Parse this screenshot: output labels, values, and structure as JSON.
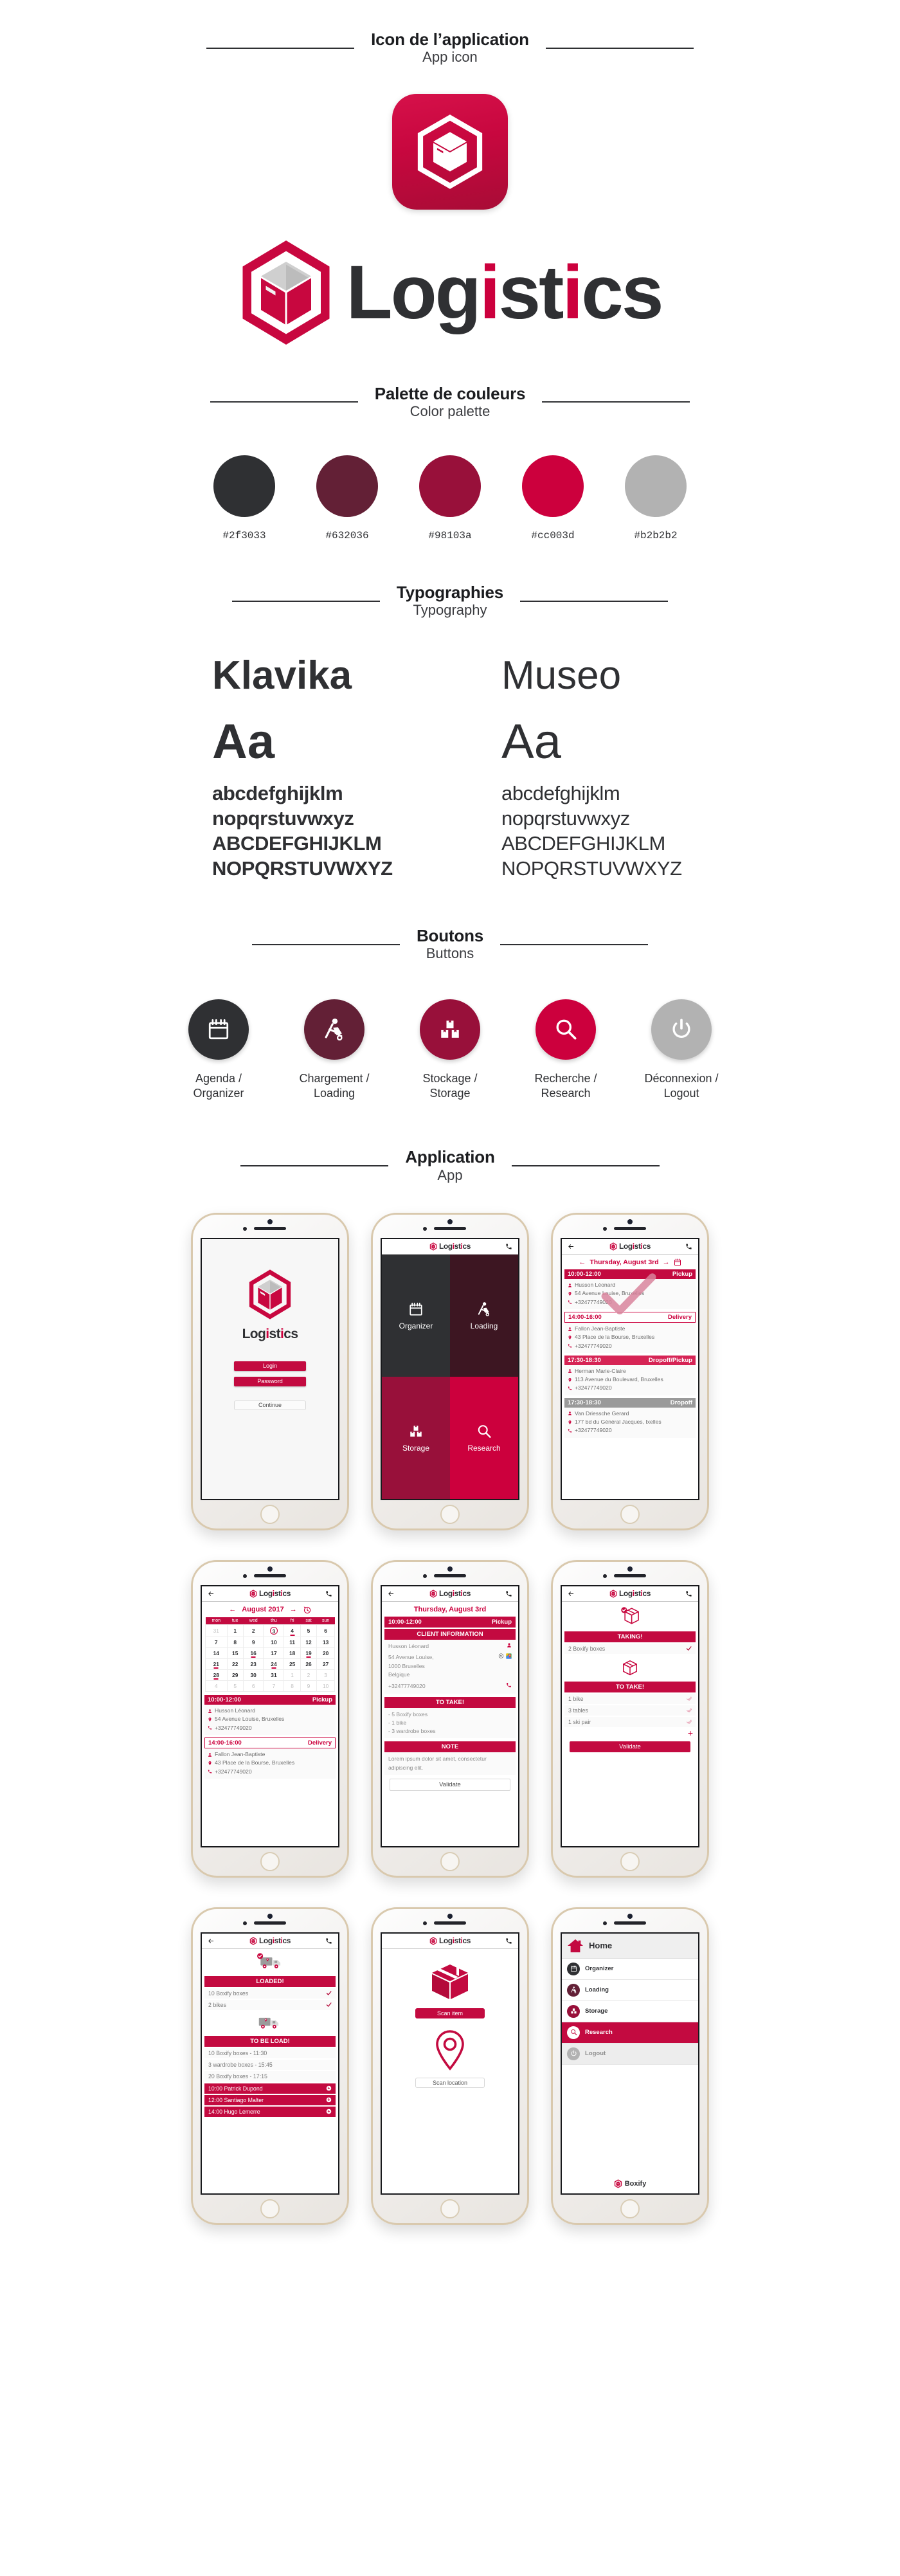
{
  "brand": {
    "name": "Logistics",
    "name_prefix": "Log",
    "name_dot": "i",
    "name_mid": "st",
    "name_dot2": "i",
    "name_suffix": "cs"
  },
  "sections": {
    "app_icon": {
      "fr": "Icon de l’application",
      "en": "App icon"
    },
    "palette": {
      "fr": "Palette de couleurs",
      "en": "Color palette"
    },
    "typography": {
      "fr": "Typographies",
      "en": "Typography"
    },
    "buttons": {
      "fr": "Boutons",
      "en": "Buttons"
    },
    "application": {
      "fr": "Application",
      "en": "App"
    }
  },
  "palette": [
    {
      "hex": "#2f3033",
      "label": "#2f3033"
    },
    {
      "hex": "#632036",
      "label": "#632036"
    },
    {
      "hex": "#98103a",
      "label": "#98103a"
    },
    {
      "hex": "#cc003d",
      "label": "#cc003d"
    },
    {
      "hex": "#b2b2b2",
      "label": "#b2b2b2"
    }
  ],
  "typography": [
    {
      "name": "Klavika",
      "aa": "Aa",
      "lines": [
        "abcdefghijklm",
        "nopqrstuvwxyz",
        "ABCDEFGHIJKLM",
        "NOPQRSTUVWXYZ"
      ]
    },
    {
      "name": "Museo",
      "aa": "Aa",
      "lines": [
        "abcdefghijklm",
        "nopqrstuvwxyz",
        "ABCDEFGHIJKLM",
        "NOPQRSTUVWXYZ"
      ]
    }
  ],
  "buttons": [
    {
      "icon": "calendar-icon",
      "color": "#2f3033",
      "line1": "Agenda /",
      "line2": "Organizer"
    },
    {
      "icon": "handtruck-icon",
      "color": "#632036",
      "line1": "Chargement /",
      "line2": "Loading"
    },
    {
      "icon": "boxes-icon",
      "color": "#98103a",
      "line1": "Stockage /",
      "line2": "Storage"
    },
    {
      "icon": "search-icon",
      "color": "#cc003d",
      "line1": "Recherche /",
      "line2": "Research"
    },
    {
      "icon": "power-icon",
      "color": "#b2b2b2",
      "line1": "Déconnexion /",
      "line2": "Logout"
    }
  ],
  "screens": {
    "login": {
      "title": "Logistics",
      "login_label": "Login",
      "password_label": "Password",
      "continue_label": "Continue"
    },
    "tiles": [
      {
        "label": "Organizer",
        "color": "#2f3033",
        "icon": "calendar-icon"
      },
      {
        "label": "Loading",
        "color": "#3d1622",
        "icon": "handtruck-icon"
      },
      {
        "label": "Storage",
        "color": "#98103a",
        "icon": "boxes-icon"
      },
      {
        "label": "Research",
        "color": "#cc003d",
        "icon": "search-icon"
      }
    ],
    "schedule": {
      "day_label": "Thursday, August 3rd",
      "prev_arrow": "←",
      "next_arrow": "→",
      "appointments": [
        {
          "time": "10:00-12:00",
          "type": "Pickup",
          "style": "solid-dark",
          "name": "Husson Léonard",
          "address": "54 Avenue Louise, Bruxelles",
          "phone": "+32477749020"
        },
        {
          "time": "14:00-16:00",
          "type": "Delivery",
          "style": "outline",
          "name": "Fallon Jean-Baptiste",
          "address": "43 Place de la Bourse, Bruxelles",
          "phone": "+32477749020"
        },
        {
          "time": "17:30-18:30",
          "type": "Dropoff/Pickup",
          "style": "pink",
          "name": "Herman Marie-Claire",
          "address": "113 Avenue du Boulevard, Bruxelles",
          "phone": "+32477749020"
        },
        {
          "time": "17:30-18:30",
          "type": "Dropoff",
          "style": "gray",
          "name": "Van Driessche Gerard",
          "address": "177 bd du Général Jacques, Ixelles",
          "phone": "+32477749020"
        }
      ]
    },
    "calendar": {
      "month": "August 2017",
      "prev_arrow": "←",
      "next_arrow": "→",
      "weekdays": [
        "mon",
        "tue",
        "wed",
        "thu",
        "fri",
        "sat",
        "sun"
      ],
      "weeks": [
        [
          {
            "d": "31",
            "mute": true
          },
          {
            "d": "1"
          },
          {
            "d": "2"
          },
          {
            "d": "3",
            "sel": true
          },
          {
            "d": "4",
            "dots": true
          },
          {
            "d": "5"
          },
          {
            "d": "6"
          }
        ],
        [
          {
            "d": "7"
          },
          {
            "d": "8"
          },
          {
            "d": "9"
          },
          {
            "d": "10"
          },
          {
            "d": "11"
          },
          {
            "d": "12"
          },
          {
            "d": "13"
          }
        ],
        [
          {
            "d": "14"
          },
          {
            "d": "15"
          },
          {
            "d": "16",
            "dots": true
          },
          {
            "d": "17"
          },
          {
            "d": "18"
          },
          {
            "d": "19",
            "dots": true
          },
          {
            "d": "20"
          }
        ],
        [
          {
            "d": "21",
            "dots": true
          },
          {
            "d": "22"
          },
          {
            "d": "23"
          },
          {
            "d": "24",
            "dots": true
          },
          {
            "d": "25"
          },
          {
            "d": "26"
          },
          {
            "d": "27"
          }
        ],
        [
          {
            "d": "28",
            "dots": true
          },
          {
            "d": "29"
          },
          {
            "d": "30"
          },
          {
            "d": "31"
          },
          {
            "d": "1",
            "mute": true
          },
          {
            "d": "2",
            "mute": true
          },
          {
            "d": "3",
            "mute": true
          }
        ],
        [
          {
            "d": "4",
            "mute": true
          },
          {
            "d": "5",
            "mute": true
          },
          {
            "d": "6",
            "mute": true
          },
          {
            "d": "7",
            "mute": true
          },
          {
            "d": "8",
            "mute": true
          },
          {
            "d": "9",
            "mute": true
          },
          {
            "d": "10",
            "mute": true
          }
        ]
      ],
      "appointments": [
        {
          "time": "10:00-12:00",
          "type": "Pickup",
          "style": "solid-dark",
          "name": "Husson Léonard",
          "address": "54 Avenue Louise, Bruxelles",
          "phone": "+32477749020"
        },
        {
          "time": "14:00-16:00",
          "type": "Delivery",
          "style": "outline",
          "name": "Fallon Jean-Baptiste",
          "address": "43 Place de la Bourse, Bruxelles",
          "phone": "+32477749020"
        }
      ]
    },
    "client_info": {
      "date": "Thursday, August 3rd",
      "time": "10:00-12:00",
      "type": "Pickup",
      "client_header": "CLIENT INFORMATION",
      "client_name": "Husson Léonard",
      "address_line1": "54 Avenue Louise,",
      "address_line2": "1000 Bruxelles",
      "address_line3": "Belgique",
      "phone": "+32477749020",
      "to_take_header": "TO TAKE!",
      "to_take_items": [
        "- 5 Boxify boxes",
        "- 1 bike",
        "- 3 wardrobe boxes"
      ],
      "note_header": "NOTE",
      "note_text": "Lorem ipsum dolor sit amet, consectetur adipiscing elit.",
      "validate_label": "Validate"
    },
    "taking": {
      "taking_header": "TAKING!",
      "taking_items": [
        {
          "label": "2 Boxify boxes",
          "checked": true
        }
      ],
      "to_take_header": "TO TAKE!",
      "to_take_items": [
        {
          "label": "1 bike",
          "checked": false
        },
        {
          "label": "3 tables",
          "checked": false
        },
        {
          "label": "1 ski pair",
          "checked": false
        }
      ],
      "add_label": "+",
      "validate_label": "Validate"
    },
    "loading": {
      "loaded_header": "LOADED!",
      "loaded_items": [
        {
          "label": "10 Boxify boxes",
          "checked": true
        },
        {
          "label": "2 bikes",
          "checked": true
        }
      ],
      "to_load_header": "TO BE LOAD!",
      "to_load_items": [
        "10 Boxify boxes - 11:30",
        "3 wardrobe boxes - 15:45",
        "20 Boxify boxes - 17:15"
      ],
      "stops": [
        "10:00 Patrick Dupond",
        "12:00 Santiago Malter",
        "14:00 Hugo Lemerre"
      ]
    },
    "scan": {
      "scan_item_label": "Scan item",
      "scan_location_label": "Scan location"
    },
    "drawer": {
      "home_label": "Home",
      "items": [
        {
          "label": "Organizer",
          "icon": "calendar-icon",
          "color": "#2f3033",
          "state": "normal"
        },
        {
          "label": "Loading",
          "icon": "handtruck-icon",
          "color": "#632036",
          "state": "normal"
        },
        {
          "label": "Storage",
          "icon": "boxes-icon",
          "color": "#98103a",
          "state": "normal"
        },
        {
          "label": "Research",
          "icon": "search-icon",
          "color": "#ffffff",
          "state": "active"
        },
        {
          "label": "Logout",
          "icon": "power-icon",
          "color": "#b2b2b2",
          "state": "muted"
        }
      ],
      "footer_label": "Boxify"
    }
  }
}
